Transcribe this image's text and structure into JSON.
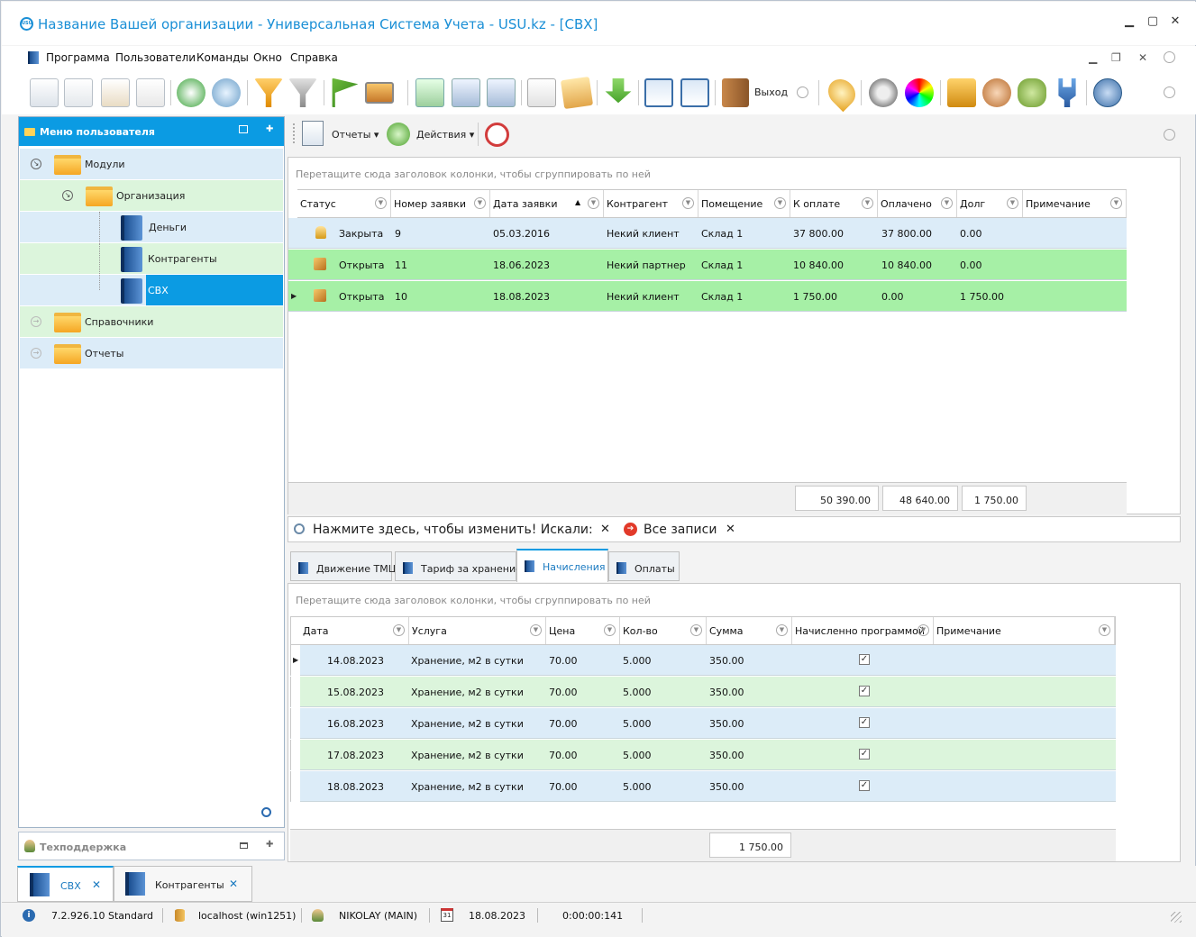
{
  "window": {
    "title": "Название Вашей организации - Универсальная Система Учета - USU.kz -  [СВХ]",
    "logo_text": "USU",
    "minimize": "▁",
    "maximize": "▢",
    "close": "✕"
  },
  "menu": {
    "items": [
      "Программа",
      "Пользователи",
      "Команды",
      "Окно",
      "Справка"
    ],
    "mdi_min": "▁",
    "mdi_restore": "❐",
    "mdi_close": "✕"
  },
  "toolbar": {
    "exit_label": "Выход"
  },
  "left_panel": {
    "title": "Меню пользователя",
    "tree": {
      "modules": "Модули",
      "organization": "Организация",
      "money": "Деньги",
      "contractors": "Контрагенты",
      "svh": "СВХ",
      "references": "Справочники",
      "reports": "Отчеты"
    },
    "support_title": "Техподдержка"
  },
  "sub_toolbar": {
    "reports": "Отчеты",
    "actions": "Действия"
  },
  "grid1": {
    "group_hint": "Перетащите сюда заголовок колонки, чтобы сгруппировать по ней",
    "columns": [
      "Статус",
      "Номер заявки",
      "Дата заявки",
      "Контрагент",
      "Помещение",
      "К оплате",
      "Оплачено",
      "Долг",
      "Примечание"
    ],
    "rows": [
      {
        "status": "Закрыта",
        "num": "9",
        "date": "05.03.2016",
        "contractor": "Некий клиент",
        "room": "Склад 1",
        "to_pay": "37 800.00",
        "paid": "37 800.00",
        "debt": "0.00",
        "note": ""
      },
      {
        "status": "Открыта",
        "num": "11",
        "date": "18.06.2023",
        "contractor": "Некий партнер",
        "room": "Склад 1",
        "to_pay": "10 840.00",
        "paid": "10 840.00",
        "debt": "0.00",
        "note": ""
      },
      {
        "status": "Открыта",
        "num": "10",
        "date": "18.08.2023",
        "contractor": "Некий клиент",
        "room": "Склад 1",
        "to_pay": "1 750.00",
        "paid": "0.00",
        "debt": "1 750.00",
        "note": ""
      }
    ],
    "totals": {
      "to_pay": "50 390.00",
      "paid": "48 640.00",
      "debt": "1 750.00"
    }
  },
  "filter": {
    "prompt": "Нажмите здесь, чтобы изменить! Искали:",
    "close1": "✕",
    "value": "Все записи",
    "close2": "✕"
  },
  "tabs": [
    "Движение ТМЦ",
    "Тариф за хранение",
    "Начисления",
    "Оплаты"
  ],
  "grid2": {
    "group_hint": "Перетащите сюда заголовок колонки, чтобы сгруппировать по ней",
    "columns": [
      "Дата",
      "Услуга",
      "Цена",
      "Кол-во",
      "Сумма",
      "Начисленно программой",
      "Примечание"
    ],
    "rows": [
      {
        "date": "14.08.2023",
        "service": "Хранение, м2 в сутки",
        "price": "70.00",
        "qty": "5.000",
        "sum": "350.00",
        "check": "✓"
      },
      {
        "date": "15.08.2023",
        "service": "Хранение, м2 в сутки",
        "price": "70.00",
        "qty": "5.000",
        "sum": "350.00",
        "check": "✓"
      },
      {
        "date": "16.08.2023",
        "service": "Хранение, м2 в сутки",
        "price": "70.00",
        "qty": "5.000",
        "sum": "350.00",
        "check": "✓"
      },
      {
        "date": "17.08.2023",
        "service": "Хранение, м2 в сутки",
        "price": "70.00",
        "qty": "5.000",
        "sum": "350.00",
        "check": "✓"
      },
      {
        "date": "18.08.2023",
        "service": "Хранение, м2 в сутки",
        "price": "70.00",
        "qty": "5.000",
        "sum": "350.00",
        "check": "✓"
      }
    ],
    "total": "1 750.00"
  },
  "doc_tabs": [
    {
      "label": "СВХ",
      "close": "✕"
    },
    {
      "label": "Контрагенты",
      "close": "✕"
    }
  ],
  "status": {
    "version": "7.2.926.10 Standard",
    "db": "localhost (win1251)",
    "user": "NIKOLAY (MAIN)",
    "calendar_day": "31",
    "date": "18.08.2023",
    "time": "0:00:00:141"
  }
}
